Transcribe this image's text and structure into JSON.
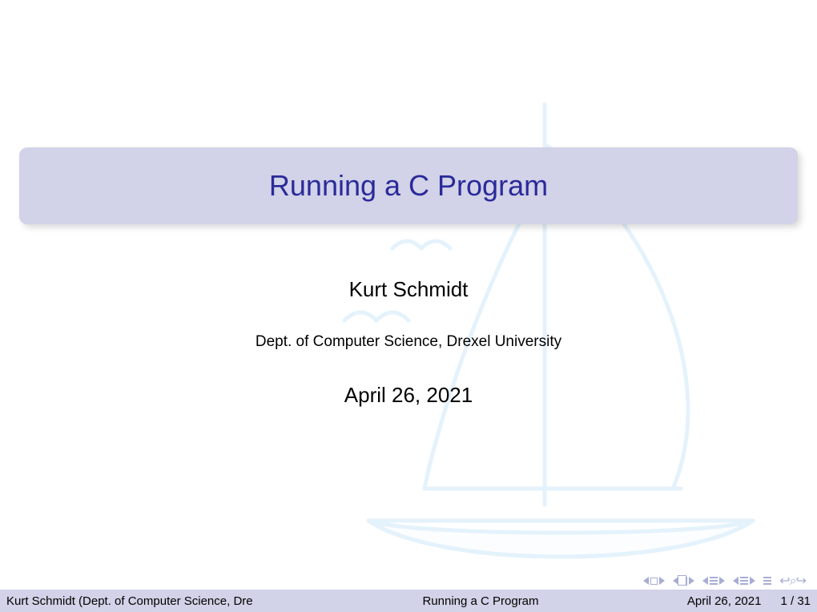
{
  "title": "Running a C Program",
  "author": "Kurt Schmidt",
  "affiliation": "Dept. of Computer Science, Drexel University",
  "date": "April 26, 2021",
  "footer": {
    "left": "Kurt Schmidt (Dept. of Computer Science, Dre",
    "center": "Running a C Program",
    "date": "April 26, 2021",
    "page": "1 / 31"
  },
  "nav": {
    "undo_glyph": "↩",
    "search_glyph": "⌕",
    "redo_glyph": "↪"
  }
}
